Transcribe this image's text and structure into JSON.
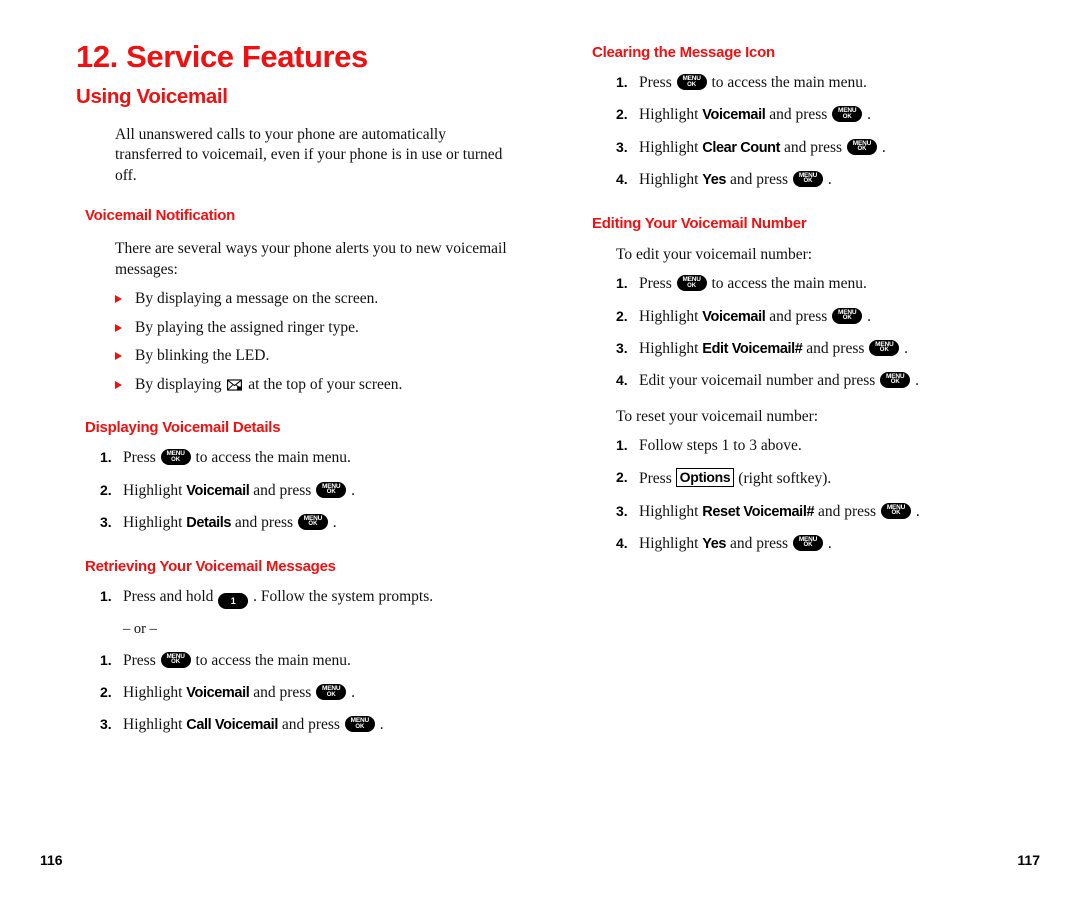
{
  "document": {
    "chapter_title": "12. Service Features",
    "left_folio": "116",
    "right_folio": "117"
  },
  "icons": {
    "menu_ok_key_line1": "MENU",
    "menu_ok_key_line2": "OK",
    "one_key": "1",
    "envelope": "envelope-icon",
    "bullet": "arrow-bullet-icon"
  },
  "left_column": {
    "section_title": "Using Voicemail",
    "intro": "All unanswered calls to your phone are automatically transferred to voicemail, even if your phone is in use or turned off.",
    "notification": {
      "heading": "Voicemail Notification",
      "intro": "There are several ways your phone alerts you to new voicemail messages:",
      "bullets": [
        {
          "pre": "By displaying a message on the screen.",
          "post": ""
        },
        {
          "pre": "By playing the assigned ringer type.",
          "post": ""
        },
        {
          "pre": "By blinking the LED.",
          "post": ""
        },
        {
          "pre": "By displaying",
          "post": "at the top of your screen."
        }
      ]
    },
    "displaying_details": {
      "heading": "Displaying Voicemail Details",
      "steps": [
        {
          "num": "1.",
          "pre": "Press",
          "item": "",
          "mid": "",
          "post": "to access the main menu."
        },
        {
          "num": "2.",
          "pre": "Highlight",
          "item": "Voicemail",
          "mid": "and press",
          "post": "."
        },
        {
          "num": "3.",
          "pre": "Highlight",
          "item": "Details",
          "mid": "and press",
          "post": "."
        }
      ]
    },
    "retrieving": {
      "heading": "Retrieving Your Voicemail Messages",
      "step_hold": {
        "num": "1.",
        "pre": "Press and hold",
        "post": ". Follow the system prompts."
      },
      "or_separator": "– or –",
      "steps": [
        {
          "num": "1.",
          "pre": "Press",
          "item": "",
          "mid": "",
          "post": "to access the main menu."
        },
        {
          "num": "2.",
          "pre": "Highlight",
          "item": "Voicemail",
          "mid": "and press",
          "post": "."
        },
        {
          "num": "3.",
          "pre": "Highlight",
          "item": "Call Voicemail",
          "mid": "and press",
          "post": "."
        }
      ]
    }
  },
  "right_column": {
    "clearing": {
      "heading": "Clearing the Message Icon",
      "steps": [
        {
          "num": "1.",
          "pre": "Press",
          "item": "",
          "mid": "",
          "post": "to access the main menu."
        },
        {
          "num": "2.",
          "pre": "Highlight",
          "item": "Voicemail",
          "mid": "and press",
          "post": "."
        },
        {
          "num": "3.",
          "pre": "Highlight",
          "item": "Clear Count",
          "mid": "and press",
          "post": "."
        },
        {
          "num": "4.",
          "pre": "Highlight",
          "item": "Yes",
          "mid": "and press",
          "post": "."
        }
      ]
    },
    "editing": {
      "heading": "Editing Your Voicemail Number",
      "intro_edit": "To edit your voicemail number:",
      "edit_steps": [
        {
          "num": "1.",
          "pre": "Press",
          "item": "",
          "mid": "",
          "post": "to access the main menu."
        },
        {
          "num": "2.",
          "pre": "Highlight",
          "item": "Voicemail",
          "mid": "and press",
          "post": "."
        },
        {
          "num": "3.",
          "pre": "Highlight",
          "item": "Edit Voicemail#",
          "mid": "and press",
          "post": "."
        },
        {
          "num": "4.",
          "pre": "Edit your voicemail number and press",
          "item": "",
          "mid": "",
          "post": "."
        }
      ],
      "intro_reset": "To reset your voicemail number:",
      "reset_step1": {
        "num": "1.",
        "text": "Follow steps 1 to 3 above."
      },
      "reset_step2": {
        "num": "2.",
        "pre": "Press",
        "softkey": "Options",
        "post": "(right softkey)."
      },
      "reset_steps": [
        {
          "num": "3.",
          "pre": "Highlight",
          "item": "Reset Voicemail#",
          "mid": "and press",
          "post": "."
        },
        {
          "num": "4.",
          "pre": "Highlight",
          "item": "Yes",
          "mid": "and press",
          "post": "."
        }
      ]
    }
  }
}
